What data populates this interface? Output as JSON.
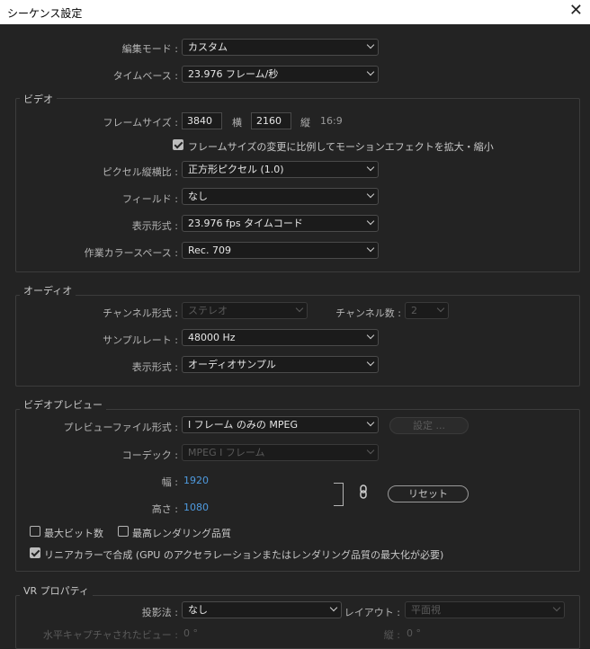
{
  "window": {
    "title": "シーケンス設定",
    "close_glyph": "✕"
  },
  "top": {
    "edit_mode_label": "編集モード :",
    "edit_mode_value": "カスタム",
    "timebase_label": "タイムベース :",
    "timebase_value": "23.976  フレーム/秒"
  },
  "video": {
    "title": "ビデオ",
    "frame_size_label": "フレームサイズ :",
    "width": "3840",
    "width_unit": "横",
    "height": "2160",
    "height_unit": "縦",
    "aspect": "16:9",
    "scale_checkbox_label": "フレームサイズの変更に比例してモーションエフェクトを拡大・縮小",
    "scale_checked": true,
    "pixel_aspect_label": "ピクセル縦横比 :",
    "pixel_aspect_value": "正方形ピクセル (1.0)",
    "fields_label": "フィールド :",
    "fields_value": "なし",
    "display_format_label": "表示形式 :",
    "display_format_value": "23.976  fps タイムコード",
    "color_space_label": "作業カラースペース :",
    "color_space_value": "Rec. 709"
  },
  "audio": {
    "title": "オーディオ",
    "channel_format_label": "チャンネル形式 :",
    "channel_format_value": "ステレオ",
    "channels_label": "チャンネル数 :",
    "channels_value": "2",
    "sample_rate_label": "サンプルレート :",
    "sample_rate_value": "48000 Hz",
    "display_format_label": "表示形式 :",
    "display_format_value": "オーディオサンプル"
  },
  "preview": {
    "title": "ビデオプレビュー",
    "file_format_label": "プレビューファイル形式 :",
    "file_format_value": "I フレーム のみの MPEG",
    "settings_button": "設定 ...",
    "codec_label": "コーデック :",
    "codec_value": "MPEG I フレーム",
    "width_label": "幅 :",
    "width_value": "1920",
    "height_label": "高さ :",
    "height_value": "1080",
    "reset_button": "リセット",
    "max_bit_depth_label": "最大ビット数",
    "max_bit_depth_checked": false,
    "max_render_quality_label": "最高レンダリング品質",
    "max_render_quality_checked": false,
    "linear_color_label": "リニアカラーで合成 (GPU のアクセラレーションまたはレンダリング品質の最大化が必要)",
    "linear_color_checked": true
  },
  "vr": {
    "title": "VR プロパティ",
    "projection_label": "投影法 :",
    "projection_value": "なし",
    "layout_label": "レイアウト :",
    "layout_value": "平面視",
    "h_fov_label": "水平キャプチャされたビュー :",
    "h_fov_value": "0 °",
    "v_label": "縦 :",
    "v_value": "0 °"
  }
}
